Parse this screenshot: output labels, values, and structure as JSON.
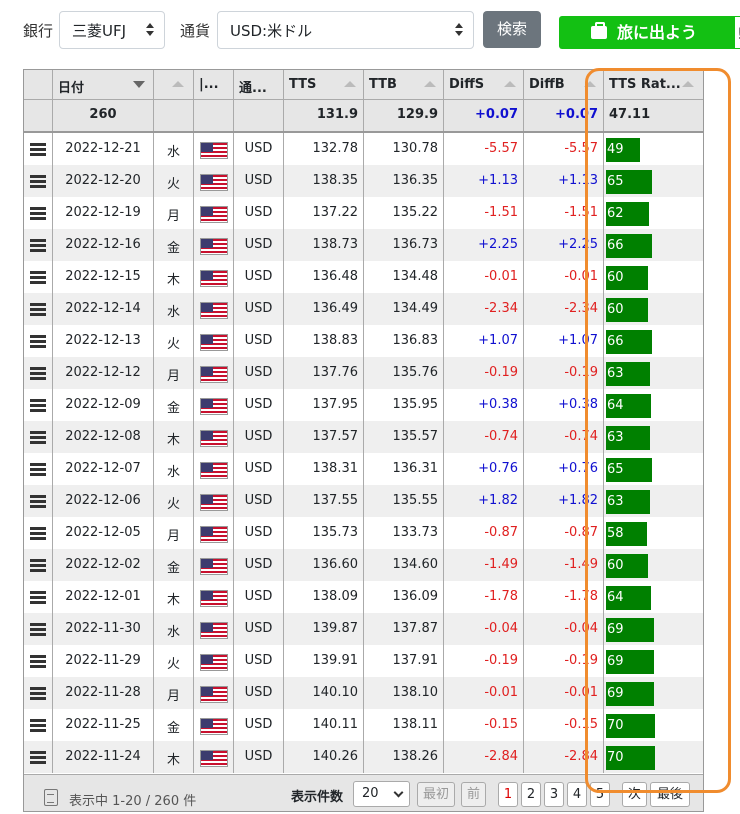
{
  "toolbar": {
    "bank_label": "銀行",
    "bank_value": "三菱UFJ",
    "currency_label": "通貨",
    "currency_value": "USD:米ドル",
    "search_label": "検索",
    "travel_label": "旅に出よう",
    "travel_extra": "!"
  },
  "table": {
    "headers": [
      "日付",
      "",
      "|...",
      "通...",
      "TTS",
      "TTB",
      "DiffS",
      "DiffB",
      "TTS Rat..."
    ],
    "calc": {
      "count": "260",
      "tts": "131.9",
      "ttb": "129.9",
      "diffs": "+0.07",
      "diffb": "+0.07",
      "ratio": "47.11"
    },
    "rows": [
      {
        "date": "2022-12-21",
        "dow": "水",
        "cur": "USD",
        "tts": "132.78",
        "ttb": "130.78",
        "diffs": "-5.57",
        "diffb": "-5.57",
        "rate": 49,
        "rate_label": "49"
      },
      {
        "date": "2022-12-20",
        "dow": "火",
        "cur": "USD",
        "tts": "138.35",
        "ttb": "136.35",
        "diffs": "+1.13",
        "diffb": "+1.13",
        "rate": 65,
        "rate_label": "65"
      },
      {
        "date": "2022-12-19",
        "dow": "月",
        "cur": "USD",
        "tts": "137.22",
        "ttb": "135.22",
        "diffs": "-1.51",
        "diffb": "-1.51",
        "rate": 62,
        "rate_label": "62"
      },
      {
        "date": "2022-12-16",
        "dow": "金",
        "cur": "USD",
        "tts": "138.73",
        "ttb": "136.73",
        "diffs": "+2.25",
        "diffb": "+2.25",
        "rate": 66,
        "rate_label": "66"
      },
      {
        "date": "2022-12-15",
        "dow": "木",
        "cur": "USD",
        "tts": "136.48",
        "ttb": "134.48",
        "diffs": "-0.01",
        "diffb": "-0.01",
        "rate": 60,
        "rate_label": "60"
      },
      {
        "date": "2022-12-14",
        "dow": "水",
        "cur": "USD",
        "tts": "136.49",
        "ttb": "134.49",
        "diffs": "-2.34",
        "diffb": "-2.34",
        "rate": 60,
        "rate_label": "60"
      },
      {
        "date": "2022-12-13",
        "dow": "火",
        "cur": "USD",
        "tts": "138.83",
        "ttb": "136.83",
        "diffs": "+1.07",
        "diffb": "+1.07",
        "rate": 66,
        "rate_label": "66"
      },
      {
        "date": "2022-12-12",
        "dow": "月",
        "cur": "USD",
        "tts": "137.76",
        "ttb": "135.76",
        "diffs": "-0.19",
        "diffb": "-0.19",
        "rate": 63,
        "rate_label": "63"
      },
      {
        "date": "2022-12-09",
        "dow": "金",
        "cur": "USD",
        "tts": "137.95",
        "ttb": "135.95",
        "diffs": "+0.38",
        "diffb": "+0.38",
        "rate": 64,
        "rate_label": "64"
      },
      {
        "date": "2022-12-08",
        "dow": "木",
        "cur": "USD",
        "tts": "137.57",
        "ttb": "135.57",
        "diffs": "-0.74",
        "diffb": "-0.74",
        "rate": 63,
        "rate_label": "63"
      },
      {
        "date": "2022-12-07",
        "dow": "水",
        "cur": "USD",
        "tts": "138.31",
        "ttb": "136.31",
        "diffs": "+0.76",
        "diffb": "+0.76",
        "rate": 65,
        "rate_label": "65"
      },
      {
        "date": "2022-12-06",
        "dow": "火",
        "cur": "USD",
        "tts": "137.55",
        "ttb": "135.55",
        "diffs": "+1.82",
        "diffb": "+1.82",
        "rate": 63,
        "rate_label": "63"
      },
      {
        "date": "2022-12-05",
        "dow": "月",
        "cur": "USD",
        "tts": "135.73",
        "ttb": "133.73",
        "diffs": "-0.87",
        "diffb": "-0.87",
        "rate": 58,
        "rate_label": "58"
      },
      {
        "date": "2022-12-02",
        "dow": "金",
        "cur": "USD",
        "tts": "136.60",
        "ttb": "134.60",
        "diffs": "-1.49",
        "diffb": "-1.49",
        "rate": 60,
        "rate_label": "60"
      },
      {
        "date": "2022-12-01",
        "dow": "木",
        "cur": "USD",
        "tts": "138.09",
        "ttb": "136.09",
        "diffs": "-1.78",
        "diffb": "-1.78",
        "rate": 64,
        "rate_label": "64"
      },
      {
        "date": "2022-11-30",
        "dow": "水",
        "cur": "USD",
        "tts": "139.87",
        "ttb": "137.87",
        "diffs": "-0.04",
        "diffb": "-0.04",
        "rate": 69,
        "rate_label": "69"
      },
      {
        "date": "2022-11-29",
        "dow": "火",
        "cur": "USD",
        "tts": "139.91",
        "ttb": "137.91",
        "diffs": "-0.19",
        "diffb": "-0.19",
        "rate": 69,
        "rate_label": "69"
      },
      {
        "date": "2022-11-28",
        "dow": "月",
        "cur": "USD",
        "tts": "140.10",
        "ttb": "138.10",
        "diffs": "-0.01",
        "diffb": "-0.01",
        "rate": 69,
        "rate_label": "69"
      },
      {
        "date": "2022-11-25",
        "dow": "金",
        "cur": "USD",
        "tts": "140.11",
        "ttb": "138.11",
        "diffs": "-0.15",
        "diffb": "-0.15",
        "rate": 70,
        "rate_label": "70"
      },
      {
        "date": "2022-11-24",
        "dow": "木",
        "cur": "USD",
        "tts": "140.26",
        "ttb": "138.26",
        "diffs": "-2.84",
        "diffb": "-2.84",
        "rate": 70,
        "rate_label": "70"
      }
    ]
  },
  "footer": {
    "info": "表示中 1-20 / 260 件",
    "page_size_label": "表示件数",
    "page_size_value": "20",
    "first_label": "最初",
    "prev_label": "前",
    "pages": [
      "1",
      "2",
      "3",
      "4",
      "5"
    ],
    "current_page": "1",
    "next_label": "次",
    "last_label": "最後"
  },
  "colors": {
    "positive": "#1010d0",
    "negative": "#e02020",
    "rate_bar": "#008000",
    "travel_button": "#13c013",
    "highlight": "#f08c2e",
    "search_button": "#6c757d"
  },
  "icons": {
    "row_handle": "drag-handle-icon",
    "flag": "us-flag-icon",
    "info": "document-icon",
    "travel": "briefcase-icon"
  }
}
